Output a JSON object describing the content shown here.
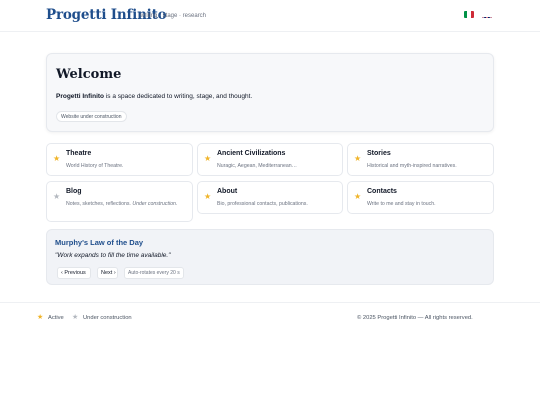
{
  "header": {
    "brand": "Progetti Infinito",
    "tagline": "writing · stage · research",
    "languages": [
      {
        "code": "it",
        "icon": "italian-flag-icon"
      },
      {
        "code": "en",
        "icon": "uk-flag-icon"
      }
    ]
  },
  "welcome": {
    "title": "Welcome",
    "brand_strong": "Progetti Infinito",
    "text_rest": " is a space dedicated to writing, stage, and thought.",
    "status_pill": "Website under construction"
  },
  "sections": [
    {
      "title": "Theatre",
      "description": "World History of Theatre.",
      "status": "active"
    },
    {
      "title": "Ancient Civilizations",
      "description": "Nuragic, Aegean, Mediterranean…",
      "status": "active"
    },
    {
      "title": "Stories",
      "description": "Historical and myth-inspired narratives.",
      "status": "active"
    },
    {
      "title": "Blog",
      "description_plain": "Notes, sketches, reflections. ",
      "description_italic": "Under construction.",
      "status": "construction"
    },
    {
      "title": "About",
      "description": "Bio, professional contacts, publications.",
      "status": "active"
    },
    {
      "title": "Contacts",
      "description": "Write to me and stay in touch.",
      "status": "active"
    }
  ],
  "murphy": {
    "title": "Murphy's Law of the Day",
    "quote": "\"Work expands to fill the time available.\"",
    "prev_label": "‹ Previous",
    "next_label": "Next ›",
    "autorotate_label": "Auto-rotates every 20 s"
  },
  "footer": {
    "legend_active": "Active",
    "legend_construction": "Under construction",
    "copyright": "© 2025 Progetti Infinito — All rights reserved."
  },
  "colors": {
    "brand": "#1f4e8c",
    "star_active": "#f0b429",
    "star_construction": "#b3b8bf"
  }
}
